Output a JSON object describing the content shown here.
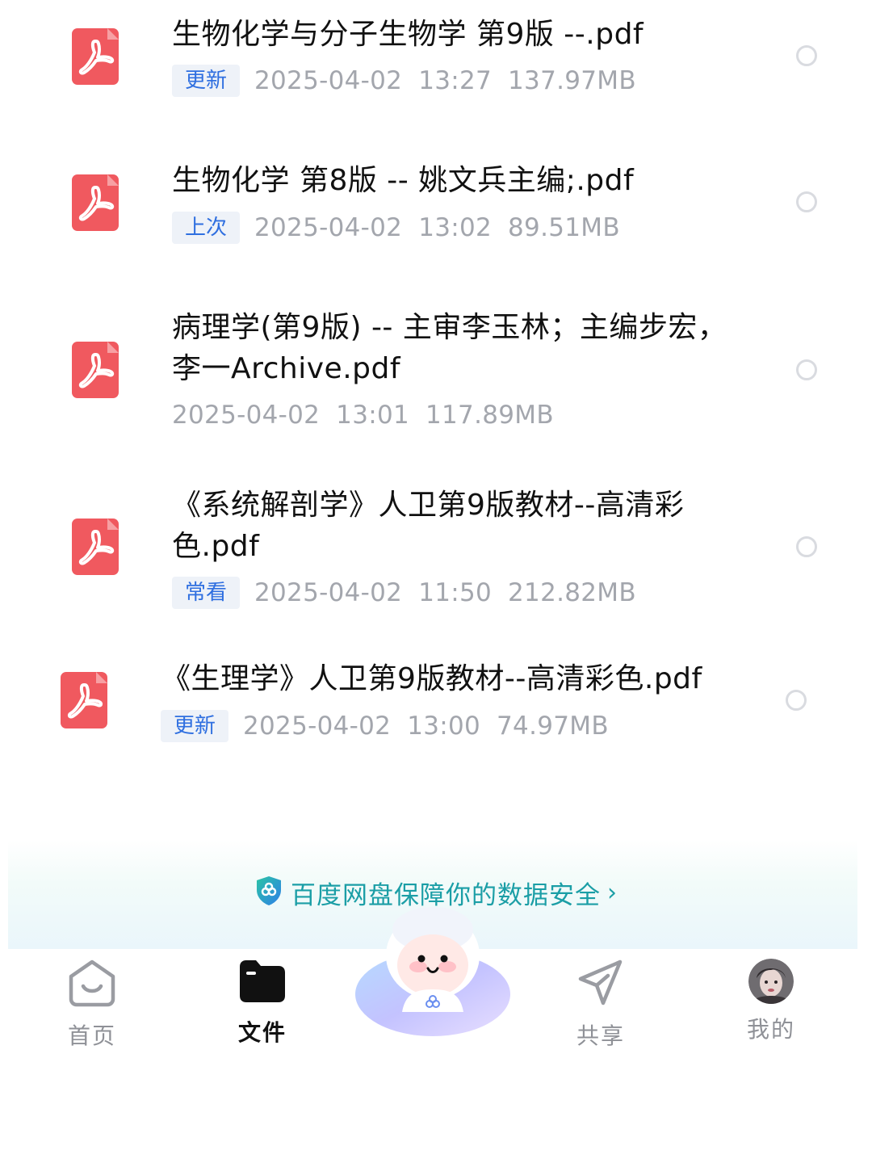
{
  "files": [
    {
      "name": "生物化学与分子生物学  第9版 --.pdf",
      "tag": "更新",
      "date": "2025-04-02",
      "time": "13:27",
      "size": "137.97MB",
      "icon": "pdf-icon"
    },
    {
      "name": "生物化学 第8版 -- 姚文兵主编;.pdf",
      "tag": "上次",
      "date": "2025-04-02",
      "time": "13:02",
      "size": "89.51MB",
      "icon": "pdf-icon"
    },
    {
      "name": "病理学(第9版) -- 主审李玉林；主编步宏，李一Archive.pdf",
      "tag": "",
      "date": "2025-04-02",
      "time": "13:01",
      "size": "117.89MB",
      "icon": "pdf-icon"
    },
    {
      "name": "《系统解剖学》人卫第9版教材--高清彩色.pdf",
      "tag": "常看",
      "date": "2025-04-02",
      "time": "11:50",
      "size": "212.82MB",
      "icon": "pdf-icon"
    },
    {
      "name": "《生理学》人卫第9版教材--高清彩色.pdf",
      "tag": "更新",
      "date": "2025-04-02",
      "time": "13:00",
      "size": "74.97MB",
      "icon": "pdf-icon"
    }
  ],
  "banner": {
    "text": "百度网盘保障你的数据安全",
    "icon": "shield-icon",
    "chevron": "›"
  },
  "nav": {
    "home": "首页",
    "files": "文件",
    "share": "共享",
    "mine": "我的"
  },
  "colors": {
    "pdf_red": "#f0595f",
    "tag_blue": "#2f6fe0",
    "tag_bg": "#eef2f8",
    "meta_gray": "#a3a6ad",
    "banner_teal": "#1b9ea6"
  }
}
